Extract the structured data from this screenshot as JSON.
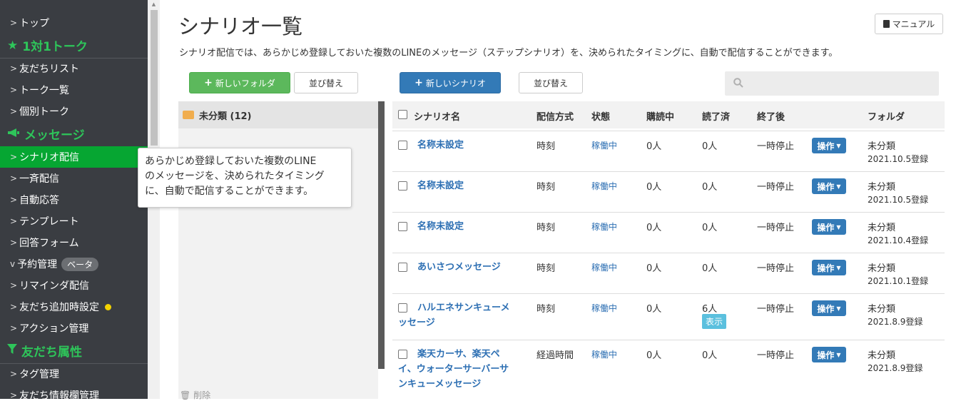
{
  "sidebar": {
    "items": [
      {
        "label": "トップ"
      },
      {
        "label": "友だちリスト"
      },
      {
        "label": "トーク一覧"
      },
      {
        "label": "個別トーク"
      },
      {
        "label": "シナリオ配信"
      },
      {
        "label": "一斉配信"
      },
      {
        "label": "自動応答"
      },
      {
        "label": "テンプレート"
      },
      {
        "label": "回答フォーム"
      },
      {
        "label": "予約管理",
        "badge": "ベータ"
      },
      {
        "label": "リマインダ配信"
      },
      {
        "label": "友だち追加時設定"
      },
      {
        "label": "アクション管理"
      },
      {
        "label": "タグ管理"
      },
      {
        "label": "友だち情報欄管理"
      }
    ],
    "sections": {
      "talk": "1対1トーク",
      "message": "メッセージ",
      "attributes": "友だち属性"
    }
  },
  "header": {
    "title": "シナリオ一覧",
    "manual_label": "マニュアル",
    "description": "シナリオ配信では、あらかじめ登録しておいた複数のLINEのメッセージ（ステップシナリオ）を、決められたタイミングに、自動で配信することができます。"
  },
  "toolbar": {
    "new_folder": "新しいフォルダ",
    "sort_left": "並び替え",
    "new_scenario": "新しいシナリオ",
    "sort_right": "並び替え",
    "search_placeholder": ""
  },
  "folders": [
    {
      "label": "未分類 (12)"
    }
  ],
  "table": {
    "headers": {
      "name": "シナリオ名",
      "method": "配信方式",
      "status": "状態",
      "subscribers": "購読中",
      "read": "読了済",
      "after_end": "終了後",
      "folder": "フォルダ"
    },
    "ops_label": "操作",
    "rows": [
      {
        "name": "名称未設定",
        "method": "時刻",
        "status": "稼働中",
        "subscribers": "0人",
        "read": "0人",
        "after_end": "一時停止",
        "folder": "未分類",
        "registered": "2021.10.5登録"
      },
      {
        "name": "名称未設定",
        "method": "時刻",
        "status": "稼働中",
        "subscribers": "0人",
        "read": "0人",
        "after_end": "一時停止",
        "folder": "未分類",
        "registered": "2021.10.5登録"
      },
      {
        "name": "名称未設定",
        "method": "時刻",
        "status": "稼働中",
        "subscribers": "0人",
        "read": "0人",
        "after_end": "一時停止",
        "folder": "未分類",
        "registered": "2021.10.4登録"
      },
      {
        "name": "あいさつメッセージ",
        "method": "時刻",
        "status": "稼働中",
        "subscribers": "0人",
        "read": "0人",
        "after_end": "一時停止",
        "folder": "未分類",
        "registered": "2021.10.1登録"
      },
      {
        "name_line1": "ハルエネサンキューメ",
        "name_line2": "ッセージ",
        "method": "時刻",
        "status": "稼働中",
        "subscribers": "0人",
        "read": "6人",
        "read_button": "表示",
        "after_end": "一時停止",
        "folder": "未分類",
        "registered": "2021.8.9登録"
      },
      {
        "name_line1": "楽天カーサ、楽天ペ",
        "name_line2": "イ、ウォーターサーバーサ",
        "name_line3": "ンキューメッセージ",
        "method": "経過時間",
        "status": "稼働中",
        "subscribers": "0人",
        "read": "0人",
        "after_end": "一時停止",
        "folder": "未分類",
        "registered": "2021.8.9登録"
      }
    ]
  },
  "tooltip": {
    "line1": "あらかじめ登録しておいた複数のLINE",
    "line2": "のメッセージを、決められたタイミング",
    "line3": "に、自動で配信することができます。"
  },
  "bottom": {
    "delete_label": "削除"
  },
  "colors": {
    "sidebar_bg": "#3a3d42",
    "sidebar_section": "#2ec55a",
    "active_item": "#06a632",
    "primary": "#337ab7",
    "success": "#5cb85c",
    "link": "#2d6fb3"
  }
}
